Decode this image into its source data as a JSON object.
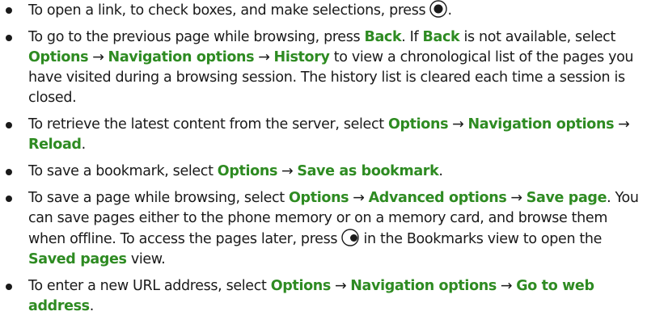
{
  "items": [
    {
      "parts": [
        {
          "t": "To open a link, to check boxes, and make selections, press "
        },
        {
          "icon": "select-key"
        },
        {
          "t": "."
        }
      ]
    },
    {
      "parts": [
        {
          "t": "To go to the previous page while browsing, press "
        },
        {
          "c": "Back"
        },
        {
          "t": ". If "
        },
        {
          "c": "Back"
        },
        {
          "t": " is not available, select "
        },
        {
          "c": "Options"
        },
        {
          "arrow": "→"
        },
        {
          "c": "Navigation options"
        },
        {
          "arrow": "→"
        },
        {
          "c": "History"
        },
        {
          "t": " to view a chronological list of the pages you have visited during a browsing session. The history list is cleared each time a session is closed."
        }
      ]
    },
    {
      "parts": [
        {
          "t": "To retrieve the latest content from the server, select "
        },
        {
          "c": "Options"
        },
        {
          "arrow": "→"
        },
        {
          "c": "Navigation options"
        },
        {
          "arrow": "→"
        },
        {
          "c": "Reload"
        },
        {
          "t": "."
        }
      ]
    },
    {
      "parts": [
        {
          "t": "To save a bookmark, select "
        },
        {
          "c": "Options"
        },
        {
          "arrow": "→"
        },
        {
          "c": "Save as bookmark"
        },
        {
          "t": "."
        }
      ]
    },
    {
      "parts": [
        {
          "t": "To save a page while browsing, select "
        },
        {
          "c": "Options"
        },
        {
          "arrow": "→"
        },
        {
          "c": "Advanced options"
        },
        {
          "arrow": "→"
        },
        {
          "c": "Save page"
        },
        {
          "t": ". You can save pages either to the phone memory or on a memory card, and browse them when offline. To access the pages later, press "
        },
        {
          "icon": "right-scroll-key"
        },
        {
          "t": " in the Bookmarks view to open the "
        },
        {
          "c": "Saved pages"
        },
        {
          "t": " view."
        }
      ]
    },
    {
      "parts": [
        {
          "t": "To enter a new URL address, select "
        },
        {
          "c": "Options"
        },
        {
          "arrow": "→"
        },
        {
          "c": "Navigation options"
        },
        {
          "arrow": "→"
        },
        {
          "c": "Go to web address"
        },
        {
          "t": "."
        }
      ]
    }
  ],
  "colors": {
    "highlight": "#2e8b22",
    "text": "#1a1a1a"
  }
}
